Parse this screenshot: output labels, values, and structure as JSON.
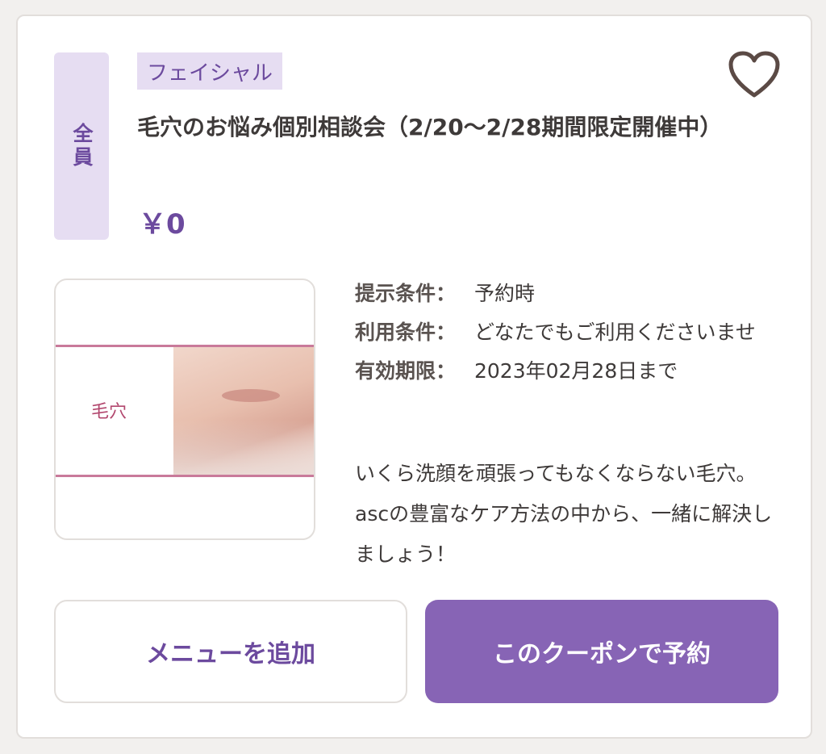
{
  "coupon": {
    "target": "全員",
    "category": "フェイシャル",
    "title": "毛穴のお悩み個別相談会（2/20〜2/28期間限定開催中）",
    "price": "￥0",
    "image_text": "毛穴",
    "conditions": [
      {
        "label": "提示条件：",
        "value": "予約時"
      },
      {
        "label": "利用条件：",
        "value": "どなたでもご利用くださいませ"
      },
      {
        "label": "有効期限：",
        "value": "2023年02月28日まで"
      }
    ],
    "description": "いくら洗顔を頑張ってもなくならない毛穴。ascの豊富なケア方法の中から、一緒に解決しましょう！",
    "buttons": {
      "add_menu": "メニューを追加",
      "reserve": "このクーポンで予約"
    }
  },
  "colors": {
    "accent": "#6c4a9e",
    "tag_bg": "#e6ddf2",
    "button_primary": "#8764b5",
    "heart": "#5b4a45"
  },
  "icons": {
    "favorite": "heart-outline-icon"
  }
}
